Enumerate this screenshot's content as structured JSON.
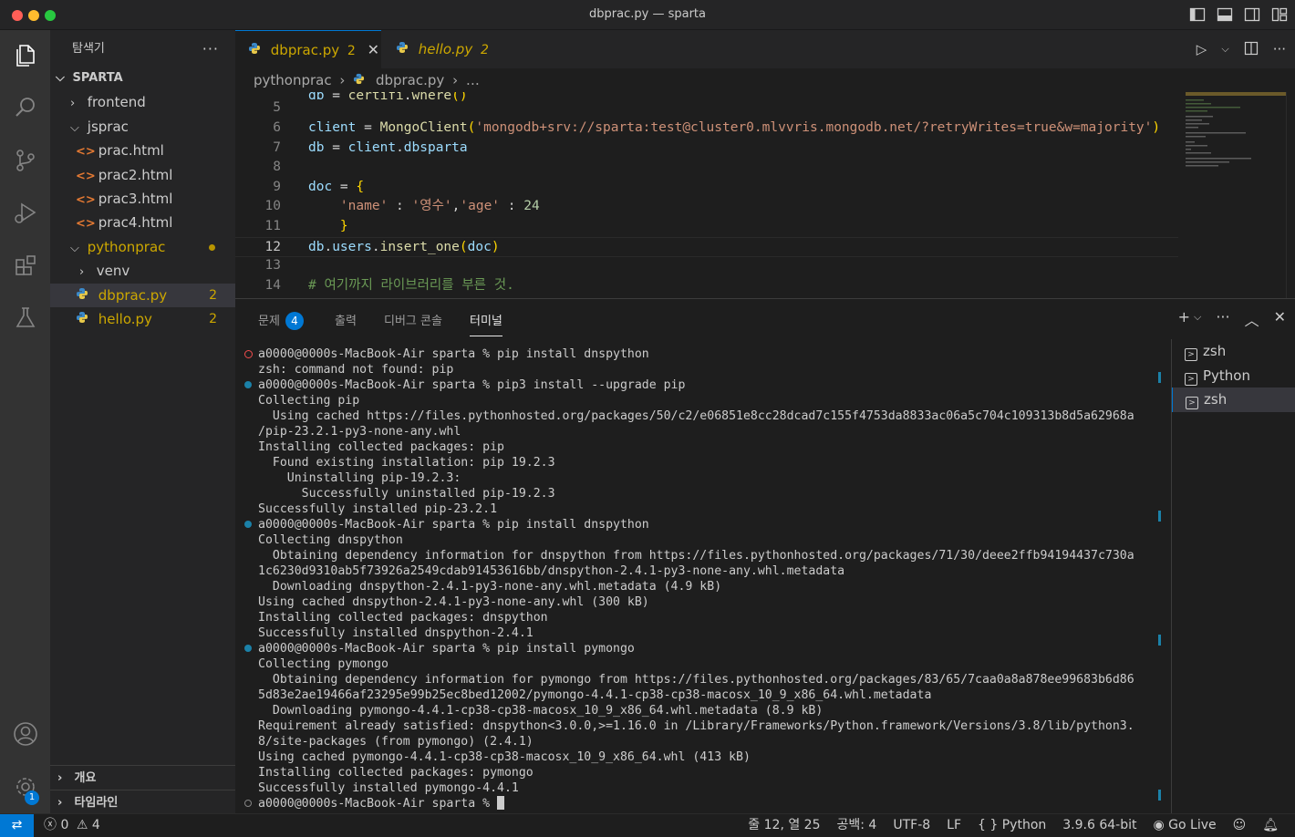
{
  "window": {
    "title": "dbprac.py — sparta"
  },
  "activity": {
    "accounts_badge": "1"
  },
  "sidebar": {
    "title": "탐색기",
    "more": "···",
    "section": "SPARTA",
    "items": [
      {
        "label": "frontend",
        "type": "folder",
        "expanded": false
      },
      {
        "label": "jsprac",
        "type": "folder",
        "expanded": true
      },
      {
        "label": "prac.html",
        "type": "html"
      },
      {
        "label": "prac2.html",
        "type": "html"
      },
      {
        "label": "prac3.html",
        "type": "html"
      },
      {
        "label": "prac4.html",
        "type": "html"
      },
      {
        "label": "pythonprac",
        "type": "folder",
        "expanded": true
      },
      {
        "label": "venv",
        "type": "folder",
        "expanded": false
      },
      {
        "label": "dbprac.py",
        "type": "py",
        "count": "2"
      },
      {
        "label": "hello.py",
        "type": "py",
        "count": "2"
      }
    ],
    "outline": "개요",
    "timeline": "타임라인"
  },
  "tabs": [
    {
      "label": "dbprac.py",
      "count": "2",
      "close": "✕"
    },
    {
      "label": "hello.py",
      "count": "2"
    }
  ],
  "breadcrumb": {
    "folder": "pythonprac",
    "file": "dbprac.py",
    "more": "…"
  },
  "editor": {
    "current_line": "12",
    "line_numbers": [
      "5",
      "6",
      "7",
      "8",
      "9",
      "10",
      "11",
      "12",
      "13",
      "14"
    ]
  },
  "panel": {
    "tabs": [
      {
        "label": "문제",
        "badge": "4"
      },
      {
        "label": "출력"
      },
      {
        "label": "디버그 콘솔"
      },
      {
        "label": "터미널"
      }
    ],
    "terminals": [
      "zsh",
      "Python",
      "zsh"
    ],
    "lines": [
      {
        "deco": "err",
        "text": "a0000@0000s-MacBook-Air sparta % pip install dnspython"
      },
      {
        "deco": "",
        "text": "zsh: command not found: pip"
      },
      {
        "deco": "ok",
        "text": "a0000@0000s-MacBook-Air sparta % pip3 install --upgrade pip"
      },
      {
        "deco": "",
        "text": "Collecting pip"
      },
      {
        "deco": "",
        "text": "  Using cached https://files.pythonhosted.org/packages/50/c2/e06851e8cc28dcad7c155f4753da8833ac06a5c704c109313b8d5a62968a"
      },
      {
        "deco": "",
        "text": "/pip-23.2.1-py3-none-any.whl"
      },
      {
        "deco": "",
        "text": "Installing collected packages: pip"
      },
      {
        "deco": "",
        "text": "  Found existing installation: pip 19.2.3"
      },
      {
        "deco": "",
        "text": "    Uninstalling pip-19.2.3:"
      },
      {
        "deco": "",
        "text": "      Successfully uninstalled pip-19.2.3"
      },
      {
        "deco": "",
        "text": "Successfully installed pip-23.2.1"
      },
      {
        "deco": "ok",
        "text": "a0000@0000s-MacBook-Air sparta % pip install dnspython"
      },
      {
        "deco": "",
        "text": "Collecting dnspython"
      },
      {
        "deco": "",
        "text": "  Obtaining dependency information for dnspython from https://files.pythonhosted.org/packages/71/30/deee2ffb94194437c730a"
      },
      {
        "deco": "",
        "text": "1c6230d9310ab5f73926a2549cdab91453616bb/dnspython-2.4.1-py3-none-any.whl.metadata"
      },
      {
        "deco": "",
        "text": "  Downloading dnspython-2.4.1-py3-none-any.whl.metadata (4.9 kB)"
      },
      {
        "deco": "",
        "text": "Using cached dnspython-2.4.1-py3-none-any.whl (300 kB)"
      },
      {
        "deco": "",
        "text": "Installing collected packages: dnspython"
      },
      {
        "deco": "",
        "text": "Successfully installed dnspython-2.4.1"
      },
      {
        "deco": "ok",
        "text": "a0000@0000s-MacBook-Air sparta % pip install pymongo"
      },
      {
        "deco": "",
        "text": "Collecting pymongo"
      },
      {
        "deco": "",
        "text": "  Obtaining dependency information for pymongo from https://files.pythonhosted.org/packages/83/65/7caa0a8a878ee99683b6d86"
      },
      {
        "deco": "",
        "text": "5d83e2ae19466af23295e99b25ec8bed12002/pymongo-4.4.1-cp38-cp38-macosx_10_9_x86_64.whl.metadata"
      },
      {
        "deco": "",
        "text": "  Downloading pymongo-4.4.1-cp38-cp38-macosx_10_9_x86_64.whl.metadata (8.9 kB)"
      },
      {
        "deco": "",
        "text": "Requirement already satisfied: dnspython<3.0.0,>=1.16.0 in /Library/Frameworks/Python.framework/Versions/3.8/lib/python3."
      },
      {
        "deco": "",
        "text": "8/site-packages (from pymongo) (2.4.1)"
      },
      {
        "deco": "",
        "text": "Using cached pymongo-4.4.1-cp38-cp38-macosx_10_9_x86_64.whl (413 kB)"
      },
      {
        "deco": "",
        "text": "Installing collected packages: pymongo"
      },
      {
        "deco": "",
        "text": "Successfully installed pymongo-4.4.1"
      },
      {
        "deco": "idle",
        "text": "a0000@0000s-MacBook-Air sparta % "
      }
    ]
  },
  "status": {
    "errors": "0",
    "warnings": "4",
    "position": "줄 12, 열 25",
    "spaces": "공백: 4",
    "encoding": "UTF-8",
    "eol": "LF",
    "language": "Python",
    "interpreter": "3.9.6 64-bit",
    "golive": "Go Live"
  },
  "colors": {
    "accent": "#0078d4",
    "warning": "#cca700",
    "error": "#f14c4c",
    "html_icon": "#e37933"
  }
}
